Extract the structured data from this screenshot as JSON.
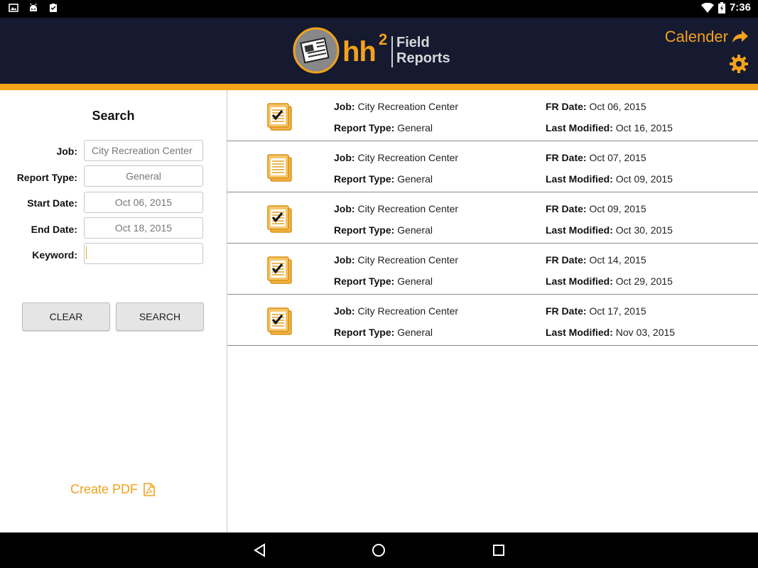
{
  "status_bar": {
    "time": "7:36"
  },
  "header": {
    "logo": {
      "hh": "hh",
      "sup": "2",
      "line1": "Field",
      "line2": "Reports"
    },
    "calendar_label": "Calender"
  },
  "search": {
    "title": "Search",
    "job_label": "Job:",
    "job_value": "City Recreation Center",
    "report_type_label": "Report Type:",
    "report_type_value": "General",
    "start_date_label": "Start Date:",
    "start_date_value": "Oct 06, 2015",
    "end_date_label": "End Date:",
    "end_date_value": "Oct 18, 2015",
    "keyword_label": "Keyword:",
    "keyword_value": "",
    "clear_label": "CLEAR",
    "search_label": "SEARCH",
    "create_pdf_label": "Create PDF"
  },
  "reports": {
    "labels": {
      "job": "Job:",
      "report_type": "Report Type:",
      "fr_date": "FR Date:",
      "last_modified": "Last Modified:"
    },
    "items": [
      {
        "job": "City Recreation Center",
        "report_type": "General",
        "fr_date": "Oct 06, 2015",
        "last_modified": "Oct 16, 2015",
        "icon": "checked-clipboard-icon"
      },
      {
        "job": "City Recreation Center",
        "report_type": "General",
        "fr_date": "Oct 07, 2015",
        "last_modified": "Oct 09, 2015",
        "icon": "clipboard-icon"
      },
      {
        "job": "City Recreation Center",
        "report_type": "General",
        "fr_date": "Oct 09, 2015",
        "last_modified": "Oct 30, 2015",
        "icon": "checked-clipboard-icon"
      },
      {
        "job": "City Recreation Center",
        "report_type": "General",
        "fr_date": "Oct 14, 2015",
        "last_modified": "Oct 29, 2015",
        "icon": "checked-clipboard-icon"
      },
      {
        "job": "City Recreation Center",
        "report_type": "General",
        "fr_date": "Oct 17, 2015",
        "last_modified": "Nov 03, 2015",
        "icon": "checked-clipboard-icon"
      }
    ]
  },
  "colors": {
    "accent": "#f3a21b",
    "header_bg": "#151a30"
  }
}
